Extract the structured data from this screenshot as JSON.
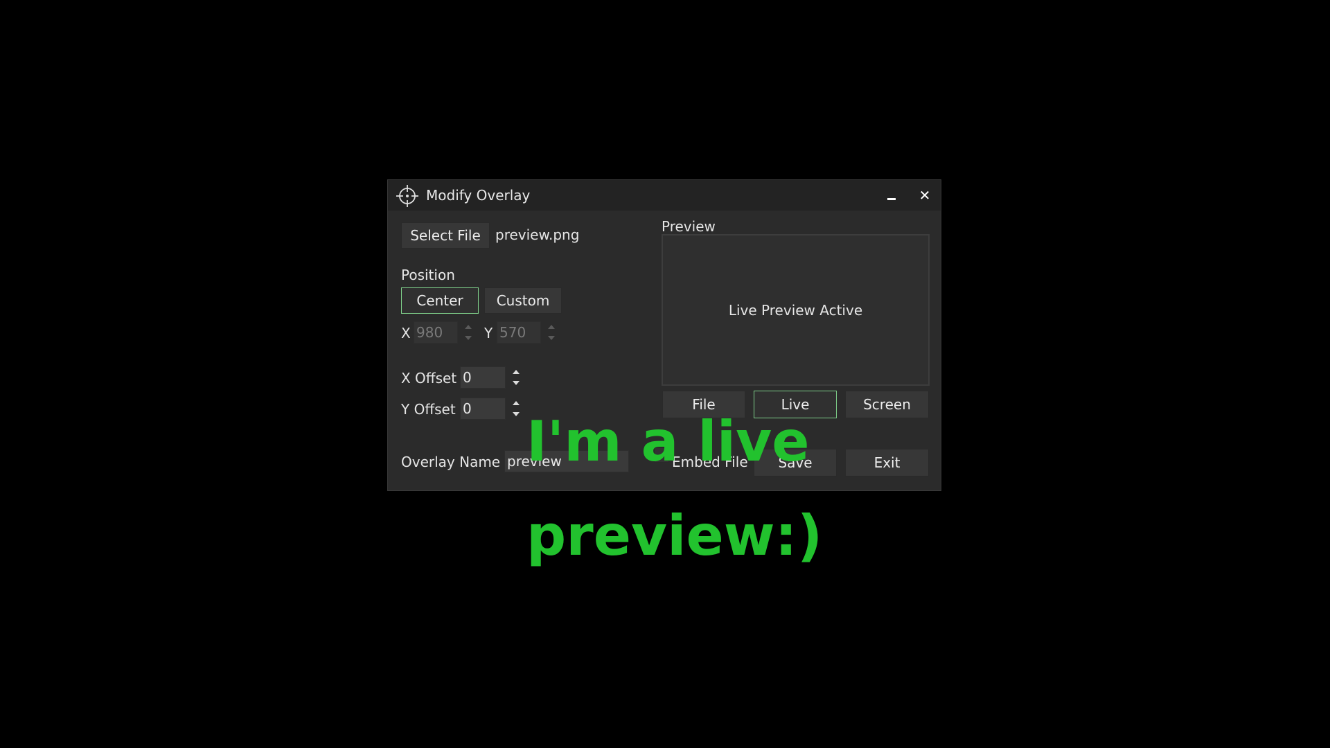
{
  "window": {
    "title": "Modify Overlay",
    "minimize_label": "–",
    "close_label": "✕"
  },
  "file": {
    "select_label": "Select File",
    "filename": "preview.png"
  },
  "position": {
    "heading": "Position",
    "center_label": "Center",
    "custom_label": "Custom",
    "selected": "Center",
    "x_label": "X",
    "x_value": "980",
    "y_label": "Y",
    "y_value": "570"
  },
  "offsets": {
    "x_label": "X Offset",
    "x_value": "0",
    "y_label": "Y Offset",
    "y_value": "0"
  },
  "name": {
    "label": "Overlay Name",
    "value": "preview"
  },
  "preview": {
    "heading": "Preview",
    "status_text": "Live Preview Active",
    "modes": [
      "File",
      "Live",
      "Screen"
    ],
    "selected_mode": "Live"
  },
  "actions": {
    "embed_label": "Embed File",
    "embed_checked": false,
    "save_label": "Save",
    "exit_label": "Exit"
  },
  "overlay": {
    "text": "I'm a live preview:)",
    "color": "#22c22e"
  },
  "colors": {
    "active_border": "#7fd08a",
    "window_bg": "#2b2b2b",
    "titlebar_bg": "#232323"
  },
  "icons": {
    "app": "crosshair-icon"
  }
}
